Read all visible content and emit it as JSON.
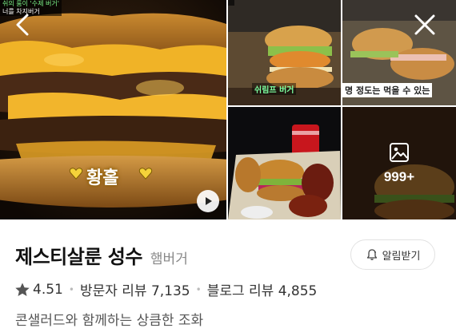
{
  "gallery": {
    "main_caption_top": [
      "쉬의 룸이 '수제 버거'",
      "너를 차지버거"
    ],
    "main_overlay_text": "황홀",
    "thumb1_caption": "쉬림프 버거",
    "thumb2_caption": "명 정도는 먹을 수 있는",
    "more_count": "999+"
  },
  "place": {
    "name": "제스티살룬 성수",
    "category": "햄버거",
    "alarm_label": "알림받기",
    "rating": "4.51",
    "visitor_reviews": "방문자 리뷰 7,135",
    "blog_reviews": "블로그 리뷰 4,855",
    "description": "콘샐러드와 함께하는 상큼한 조화"
  },
  "icons": {
    "back": "chevron-left-icon",
    "close": "close-icon",
    "play": "play-icon",
    "photo": "photo-icon",
    "bell": "bell-icon",
    "star": "star-icon"
  }
}
